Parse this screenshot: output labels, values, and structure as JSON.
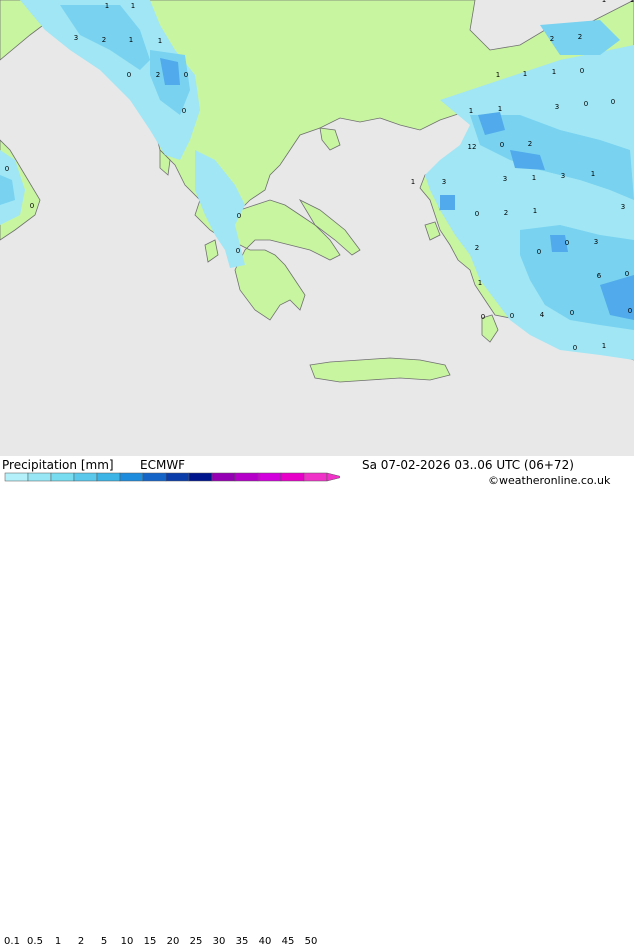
{
  "title": "Precipitation [mm]",
  "model": "ECMWF",
  "valid_time": "Sa 07-02-2026 03..06 UTC (06+72)",
  "credit": "©weatheronline.co.uk",
  "legend": {
    "labels": [
      "0.1",
      "0.5",
      "1",
      "2",
      "5",
      "10",
      "15",
      "20",
      "25",
      "30",
      "35",
      "40",
      "45",
      "50"
    ],
    "colors": [
      "#b4f0fa",
      "#96e6f5",
      "#78dcf0",
      "#5ac8eb",
      "#3cb4e6",
      "#1e8cdc",
      "#1464c8",
      "#0a3caa",
      "#00148c",
      "#9600b4",
      "#b400c8",
      "#d200dc",
      "#e600c8",
      "#f032c8"
    ]
  },
  "colors": {
    "sea": "#e8e8e8",
    "land": "#c8f5a0",
    "light_rain": "#a0e6f5",
    "moderate_rain": "#78d2f0",
    "heavy_rain": "#50aaeb"
  },
  "map_labels": [
    "1",
    "1",
    "3",
    "2",
    "1",
    "1",
    "0",
    "2",
    "0",
    "0",
    "0",
    "0",
    "1",
    "1",
    "2",
    "2",
    "1",
    "1",
    "1",
    "0",
    "3",
    "0",
    "0",
    "1",
    "1",
    "12",
    "0",
    "2",
    "3",
    "1",
    "3",
    "1",
    "1",
    "3",
    "0",
    "0",
    "2",
    "1",
    "3",
    "0",
    "2",
    "0",
    "3",
    "0",
    "1",
    "6",
    "0",
    "0",
    "4",
    "0",
    "0",
    "0",
    "1",
    "0"
  ]
}
